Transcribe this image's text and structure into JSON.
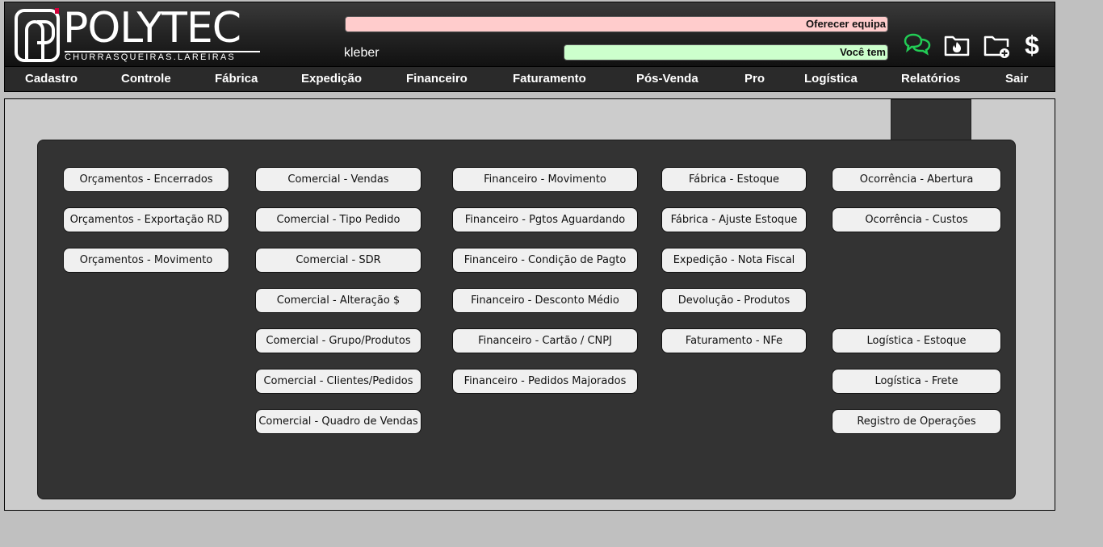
{
  "brand": {
    "name": "POLYTEC",
    "subtitle": "CHURRASQUEIRAS.LAREIRAS"
  },
  "header": {
    "ticker_red": "Oferecer equipa",
    "ticker_green": "Você tem",
    "username": "kleber",
    "icons": [
      "chat-icon",
      "folder-fire-icon",
      "folder-add-icon",
      "dollar-icon"
    ],
    "colors": {
      "chat_icon": "#22cc55",
      "ticker_red_bg": "#ffcccc",
      "ticker_green_bg": "#ccffcc"
    }
  },
  "nav": {
    "items": [
      "Cadastro",
      "Controle",
      "Fábrica",
      "Expedição",
      "Financeiro",
      "Faturamento",
      "Pós-Venda",
      "Pro",
      "Logística",
      "Relatórios",
      "Sair"
    ]
  },
  "menu": {
    "col1": [
      "Orçamentos - Encerrados",
      "Orçamentos - Exportação RD",
      "Orçamentos - Movimento"
    ],
    "col2": [
      "Comercial - Vendas",
      "Comercial - Tipo Pedido",
      "Comercial - SDR",
      "Comercial - Alteração $",
      "Comercial - Grupo/Produtos",
      "Comercial - Clientes/Pedidos",
      "Comercial - Quadro de Vendas"
    ],
    "col3": [
      "Financeiro - Movimento",
      "Financeiro - Pgtos Aguardando",
      "Financeiro - Condição de Pagto",
      "Financeiro - Desconto Médio",
      "Financeiro - Cartão / CNPJ",
      "Financeiro - Pedidos Majorados"
    ],
    "col4": [
      "Fábrica - Estoque",
      "Fábrica - Ajuste Estoque",
      "Expedição - Nota Fiscal",
      "Devolução - Produtos",
      "Faturamento - NFe"
    ],
    "col5": [
      "Ocorrência - Abertura",
      "Ocorrência - Custos",
      "Logística - Estoque",
      "Logística - Frete",
      "Registro de Operações"
    ]
  }
}
